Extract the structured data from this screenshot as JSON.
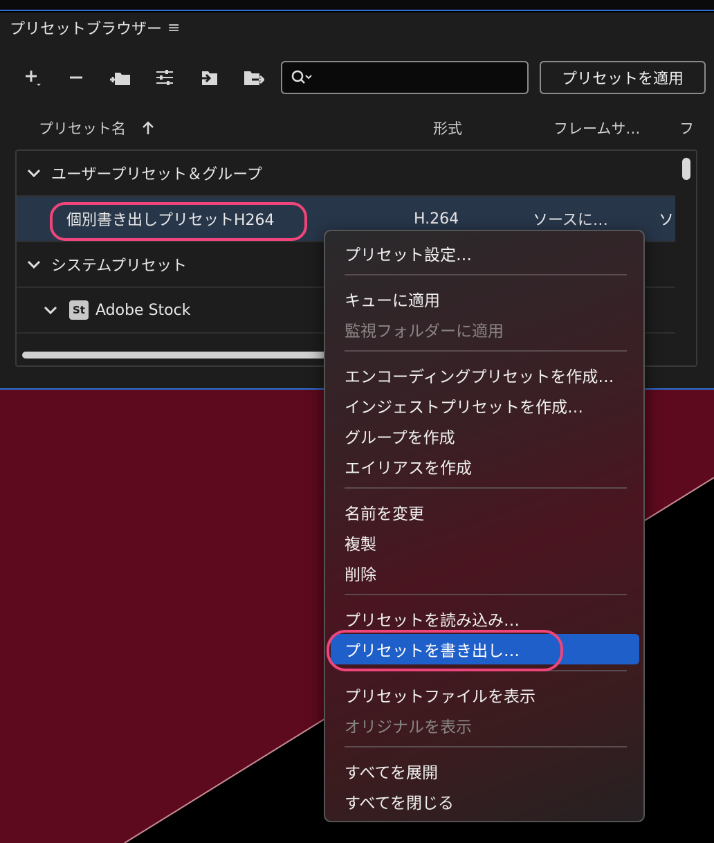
{
  "panel": {
    "title": "プリセットブラウザー",
    "menu_icon": "hamburger-icon",
    "toolbar": {
      "icons": [
        "add-icon",
        "remove-icon",
        "new-group-icon",
        "preset-settings-icon",
        "import-icon",
        "export-icon"
      ],
      "search_placeholder": "",
      "apply_button": "プリセットを適用"
    },
    "columns": {
      "name": "プリセット名",
      "sort_icon": "arrow-up-icon",
      "format": "形式",
      "frame_size": "フレームサ…",
      "next": "フ"
    },
    "tree": {
      "user_group": "ユーザープリセット＆グループ",
      "selected_row": {
        "name": "個別書き出しプリセットH264",
        "format": "H.264",
        "frame_size": "ソースに…",
        "next": "ソ"
      },
      "system_group": "システムプリセット",
      "adobe_stock": {
        "badge": "St",
        "label": "Adobe Stock"
      }
    }
  },
  "context_menu": {
    "items": [
      {
        "label": "プリセット設定…",
        "enabled": true
      },
      {
        "label": "キューに適用",
        "enabled": true
      },
      {
        "label": "監視フォルダーに適用",
        "enabled": false
      },
      {
        "label": "エンコーディングプリセットを作成…",
        "enabled": true
      },
      {
        "label": "インジェストプリセットを作成…",
        "enabled": true
      },
      {
        "label": "グループを作成",
        "enabled": true
      },
      {
        "label": "エイリアスを作成",
        "enabled": true
      },
      {
        "label": "名前を変更",
        "enabled": true
      },
      {
        "label": "複製",
        "enabled": true
      },
      {
        "label": "削除",
        "enabled": true
      },
      {
        "label": "プリセットを読み込み…",
        "enabled": true
      },
      {
        "label": "プリセットを書き出し…",
        "enabled": true,
        "highlighted": true
      },
      {
        "label": "プリセットファイルを表示",
        "enabled": true
      },
      {
        "label": "オリジナルを表示",
        "enabled": false
      },
      {
        "label": "すべてを展開",
        "enabled": true
      },
      {
        "label": "すべてを閉じる",
        "enabled": true
      }
    ]
  },
  "colors": {
    "panel_bg": "#1d1d1d",
    "selection_bg": "#28364a",
    "menu_active": "#1f5fc9",
    "annotation_ring": "#f0457a",
    "desktop_red": "#5e0a1e"
  }
}
